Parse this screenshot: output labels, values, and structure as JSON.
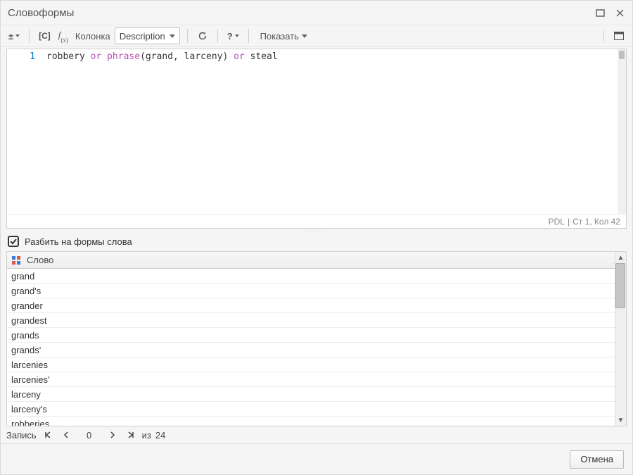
{
  "window": {
    "title": "Словоформы"
  },
  "toolbar": {
    "column_label": "Колонка",
    "column_value": "Description",
    "show_label": "Показать",
    "help_label": "?",
    "plusminus": "±"
  },
  "editor": {
    "line_number": "1",
    "tokens": {
      "t1": "robbery",
      "or1": "or",
      "fn": "phrase",
      "lp": "(",
      "a1": "grand",
      "comma": ", ",
      "a2": "larceny",
      "rp": ")",
      "or2": "or",
      "t2": "steal"
    },
    "status_lang": "PDL",
    "status_sep": "|",
    "status_pos": "Ст 1, Кол 42"
  },
  "checkbox": {
    "label": "Разбить на формы слова",
    "checked": true
  },
  "grid": {
    "header_label": "Слово",
    "rows": [
      "grand",
      "grand's",
      "grander",
      "grandest",
      "grands",
      "grands'",
      "larcenies",
      "larcenies'",
      "larceny",
      "larceny's",
      "robberies"
    ]
  },
  "statusbar": {
    "record_label": "Запись",
    "current": "0",
    "of_label": "из",
    "total": "24"
  },
  "footer": {
    "cancel": "Отмена"
  }
}
